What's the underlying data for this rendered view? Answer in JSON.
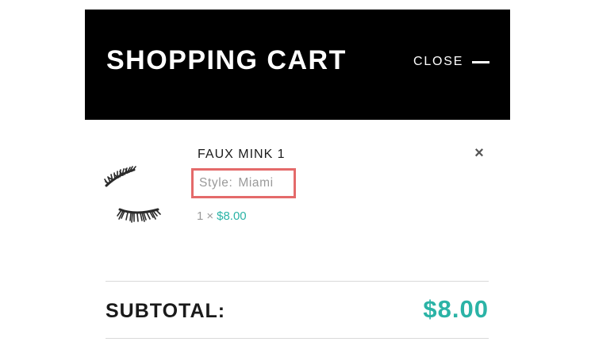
{
  "header": {
    "title": "SHOPPING CART",
    "close_label": "CLOSE"
  },
  "item": {
    "name": "FAUX MINK 1",
    "variant_key": "Style:",
    "variant_value": "Miami",
    "quantity": "1",
    "times": "×",
    "price": "$8.00",
    "remove_symbol": "×",
    "image_icon": "eyelash-product-image"
  },
  "summary": {
    "subtotal_label": "SUBTOTAL:",
    "subtotal_value": "$8.00"
  },
  "colors": {
    "header_bg": "#000000",
    "accent": "#2bb3a6",
    "highlight_border": "#e46a6a",
    "muted_text": "#9a9a9a",
    "divider": "#d9d9d9"
  }
}
